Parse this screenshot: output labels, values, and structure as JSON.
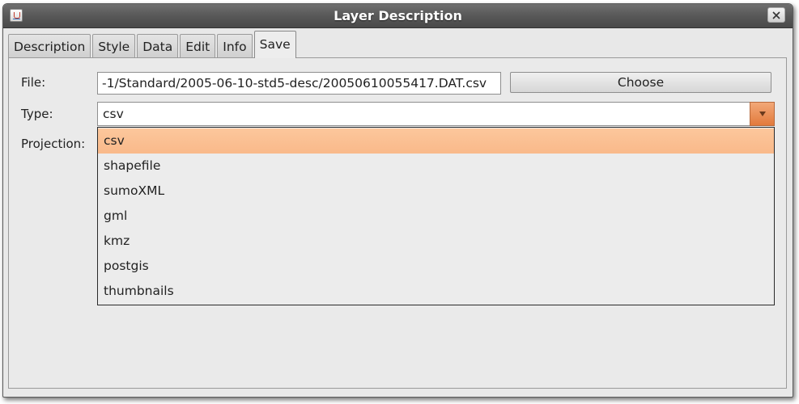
{
  "window": {
    "title": "Layer Description"
  },
  "tabs": [
    {
      "label": "Description"
    },
    {
      "label": "Style"
    },
    {
      "label": "Data"
    },
    {
      "label": "Edit"
    },
    {
      "label": "Info"
    },
    {
      "label": "Save",
      "active": true
    }
  ],
  "form": {
    "file_label": "File:",
    "file_value": "-1/Standard/2005-06-10-std5-desc/20050610055417.DAT.csv",
    "choose_label": "Choose",
    "type_label": "Type:",
    "type_value": "csv",
    "projection_label": "Projection:"
  },
  "type_options": [
    "csv",
    "shapefile",
    "sumoXML",
    "gml",
    "kmz",
    "postgis",
    "thumbnails"
  ],
  "colors": {
    "selection": "#fbbf8f",
    "combo_arrow": "#e8874a"
  },
  "icons": {
    "app": "java-app-icon",
    "close": "close-icon",
    "dropdown": "triangle-down-icon"
  }
}
